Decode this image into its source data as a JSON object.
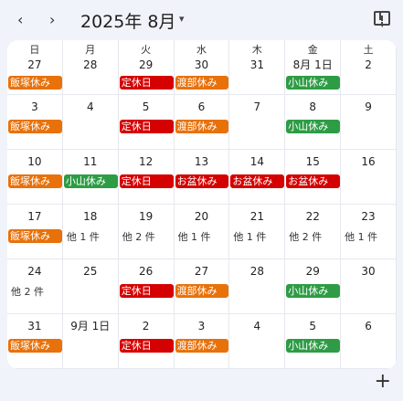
{
  "header": {
    "prev_icon": "‹",
    "next_icon": "›",
    "month_title": "2025年 8月",
    "dropdown_icon": "▾"
  },
  "weekdays": [
    "日",
    "月",
    "火",
    "水",
    "木",
    "金",
    "土"
  ],
  "weeks": [
    {
      "dates": [
        "27",
        "28",
        "29",
        "30",
        "31",
        "8月 1日",
        "2"
      ],
      "events": [
        {
          "label": "飯塚休み",
          "color": "#e8710a",
          "col": 0,
          "span": 1
        },
        {
          "label": "定休日",
          "color": "#d50000",
          "col": 2,
          "span": 1
        },
        {
          "label": "渡部休み",
          "color": "#e8710a",
          "col": 3,
          "span": 1
        },
        {
          "label": "小山休み",
          "color": "#2e9c45",
          "col": 5,
          "span": 1
        }
      ]
    },
    {
      "dates": [
        "3",
        "4",
        "5",
        "6",
        "7",
        "8",
        "9"
      ],
      "events": [
        {
          "label": "飯塚休み",
          "color": "#e8710a",
          "col": 0,
          "span": 1
        },
        {
          "label": "定休日",
          "color": "#d50000",
          "col": 2,
          "span": 1
        },
        {
          "label": "渡部休み",
          "color": "#e8710a",
          "col": 3,
          "span": 1
        },
        {
          "label": "小山休み",
          "color": "#2e9c45",
          "col": 5,
          "span": 1
        }
      ]
    },
    {
      "dates": [
        "10",
        "11",
        "12",
        "13",
        "14",
        "15",
        "16"
      ],
      "events": [
        {
          "label": "飯塚休み",
          "color": "#e8710a",
          "col": 0,
          "span": 1
        },
        {
          "label": "小山休み",
          "color": "#2e9c45",
          "col": 1,
          "span": 1
        },
        {
          "label": "定休日",
          "color": "#d50000",
          "col": 2,
          "span": 1
        },
        {
          "label": "お盆休み",
          "color": "#d50000",
          "col": 3,
          "span": 1
        },
        {
          "label": "お盆休み",
          "color": "#d50000",
          "col": 4,
          "span": 1
        },
        {
          "label": "お盆休み",
          "color": "#d50000",
          "col": 5,
          "span": 1
        }
      ]
    },
    {
      "dates": [
        "17",
        "18",
        "19",
        "20",
        "21",
        "22",
        "23"
      ],
      "events": [
        {
          "label": "飯塚休み",
          "color": "#e8710a",
          "col": 0,
          "span": 1
        }
      ],
      "more": [
        {
          "col": 1,
          "label": "他 1 件"
        },
        {
          "col": 2,
          "label": "他 2 件"
        },
        {
          "col": 3,
          "label": "他 1 件"
        },
        {
          "col": 4,
          "label": "他 1 件"
        },
        {
          "col": 5,
          "label": "他 2 件"
        },
        {
          "col": 6,
          "label": "他 1 件"
        }
      ]
    },
    {
      "dates": [
        "24",
        "25",
        "26",
        "27",
        "28",
        "29",
        "30"
      ],
      "events": [
        {
          "label": "定休日",
          "color": "#d50000",
          "col": 2,
          "span": 1
        },
        {
          "label": "渡部休み",
          "color": "#e8710a",
          "col": 3,
          "span": 1
        },
        {
          "label": "小山休み",
          "color": "#2e9c45",
          "col": 5,
          "span": 1
        }
      ],
      "more": [
        {
          "col": 0,
          "label": "他 2 件"
        }
      ]
    },
    {
      "dates": [
        "31",
        "9月 1日",
        "2",
        "3",
        "4",
        "5",
        "6"
      ],
      "events": [
        {
          "label": "飯塚休み",
          "color": "#e8710a",
          "col": 0,
          "span": 1
        },
        {
          "label": "定休日",
          "color": "#d50000",
          "col": 2,
          "span": 1
        },
        {
          "label": "渡部休み",
          "color": "#e8710a",
          "col": 3,
          "span": 1
        },
        {
          "label": "小山休み",
          "color": "#2e9c45",
          "col": 5,
          "span": 1
        }
      ]
    }
  ],
  "fab_icon": "+"
}
